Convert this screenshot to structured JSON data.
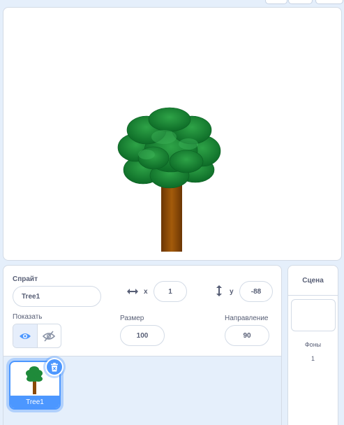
{
  "sprite_info": {
    "sprite_label": "Спрайт",
    "sprite_name": "Tree1",
    "x_label": "x",
    "x_value": "1",
    "y_label": "y",
    "y_value": "-88",
    "show_label": "Показать",
    "size_label": "Размер",
    "size_value": "100",
    "direction_label": "Направление",
    "direction_value": "90",
    "visible": true
  },
  "sprites": [
    {
      "name": "Tree1",
      "selected": true
    }
  ],
  "stage_panel": {
    "title": "Сцена",
    "backdrops_label": "Фоны",
    "backdrops_count": "1"
  },
  "icons": {
    "x_arrow": "horizontal-arrows-icon",
    "y_arrow": "vertical-arrows-icon",
    "show": "eye-icon",
    "hide": "eye-slash-icon",
    "delete": "trash-icon"
  },
  "colors": {
    "accent": "#4c97ff",
    "panel_bg": "#e5effb",
    "text": "#575e75",
    "foliage": "#1f8a3a",
    "trunk": "#8b4a08"
  }
}
